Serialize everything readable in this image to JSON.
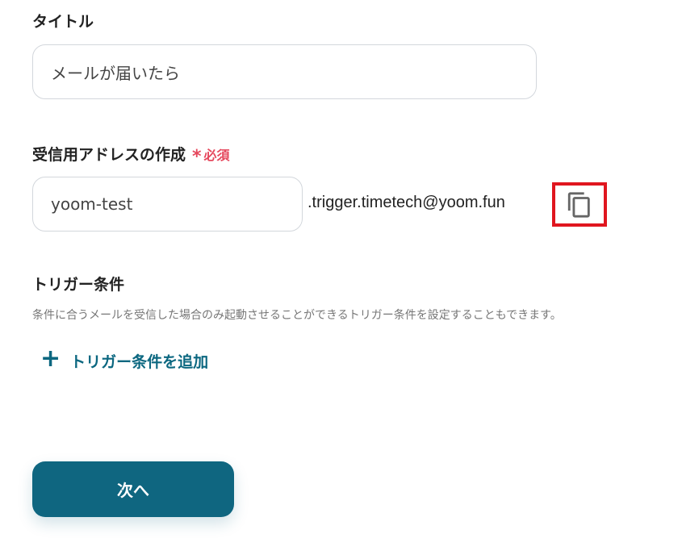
{
  "title_section": {
    "label": "タイトル",
    "value": "メールが届いたら"
  },
  "address_section": {
    "label": "受信用アドレスの作成",
    "required_mark": "*",
    "required_text": "必須",
    "local_part": "yoom-test",
    "domain": ".trigger.timetech@yoom.fun",
    "copy_icon": "copy-icon"
  },
  "trigger_section": {
    "label": "トリガー条件",
    "description": "条件に合うメールを受信した場合のみ起動させることができるトリガー条件を設定することもできます。",
    "add_icon": "plus",
    "add_label": "トリガー条件を追加"
  },
  "next_button": {
    "label": "次へ"
  },
  "colors": {
    "accent": "#0f6680",
    "required": "#e5485d",
    "highlight_border": "#e0161f"
  }
}
